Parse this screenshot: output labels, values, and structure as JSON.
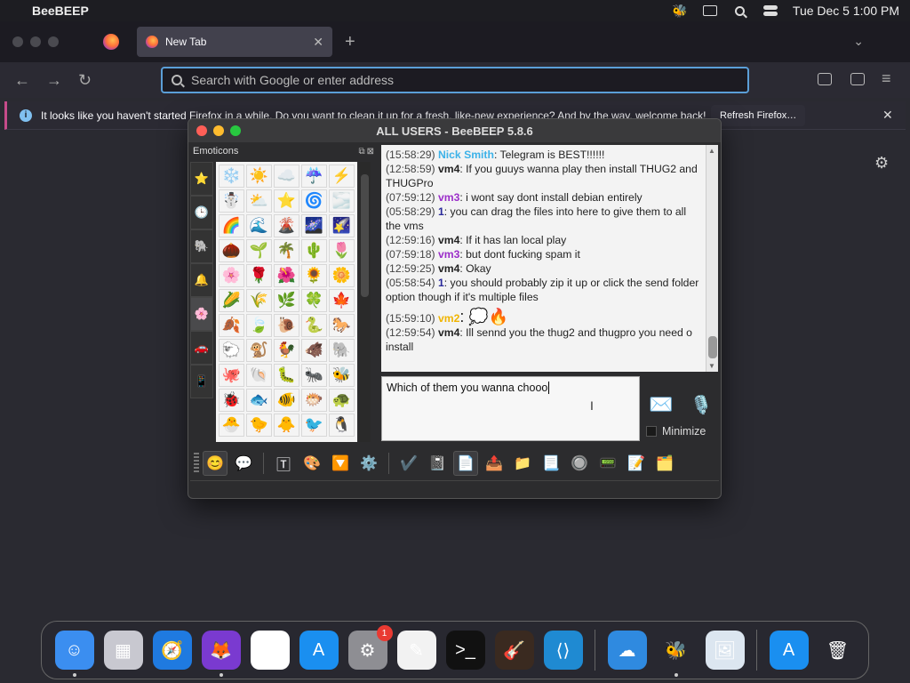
{
  "menubar": {
    "app_name": "BeeBEEP",
    "clock": "Tue Dec 5  1:00 PM"
  },
  "firefox": {
    "tab_title": "New Tab",
    "url_placeholder": "Search with Google or enter address",
    "notice_text": "It looks like you haven't started Firefox in a while. Do you want to clean it up for a fresh, like-new experience? And by the way, welcome back!",
    "refresh_label": "Refresh Firefox…"
  },
  "beebeep": {
    "title": "ALL USERS - BeeBEEP 5.8.6",
    "emoticons_label": "Emoticons",
    "emoticon_categories": [
      "⭐",
      "🕒",
      "🐘",
      "🔔",
      "🌸",
      "🚗",
      "📱"
    ],
    "emoticons": [
      "❄️",
      "☀️",
      "☁️",
      "☔",
      "⚡",
      "☃️",
      "⛅",
      "⭐",
      "🌀",
      "🌫️",
      "🌈",
      "🌊",
      "🌋",
      "🌌",
      "🌠",
      "🌰",
      "🌱",
      "🌴",
      "🌵",
      "🌷",
      "🌸",
      "🌹",
      "🌺",
      "🌻",
      "🌼",
      "🌽",
      "🌾",
      "🌿",
      "🍀",
      "🍁",
      "🍂",
      "🍃",
      "🐌",
      "🐍",
      "🐎",
      "🐑",
      "🐒",
      "🐓",
      "🐗",
      "🐘",
      "🐙",
      "🐚",
      "🐛",
      "🐜",
      "🐝",
      "🐞",
      "🐟",
      "🐠",
      "🐡",
      "🐢",
      "🐣",
      "🐤",
      "🐥",
      "🐦",
      "🐧"
    ],
    "messages": [
      {
        "time": "(15:58:29)",
        "sender": "Nick Smith",
        "color": "#3db2e8",
        "text": ": Telegram is BEST!!!!!!"
      },
      {
        "time": "(12:58:59)",
        "sender": "vm4",
        "color": "#222222",
        "text": ": If you guuys wanna play then install THUG2 and THUGPro"
      },
      {
        "time": "(07:59:12)",
        "sender": "vm3",
        "color": "#9b2ec9",
        "text": ": i wont say dont install debian entirely"
      },
      {
        "time": "(05:58:29)",
        "sender": "1",
        "color": "#2a2a9a",
        "text": ": you can drag the files into here to give them to all the vms"
      },
      {
        "time": "(12:59:16)",
        "sender": "vm4",
        "color": "#222222",
        "text": ": If it has lan local play"
      },
      {
        "time": "(07:59:18)",
        "sender": "vm3",
        "color": "#9b2ec9",
        "text": ": but dont fucking spam it"
      },
      {
        "time": "(12:59:25)",
        "sender": "vm4",
        "color": "#222222",
        "text": ": Okay"
      },
      {
        "time": "(05:58:54)",
        "sender": "1",
        "color": "#2a2a9a",
        "text": ": you should probably zip it up or click the send folder option though if it's multiple files"
      },
      {
        "time": "(15:59:10)",
        "sender": "vm2",
        "color": "#f0b400",
        "text": ": 💭🔥"
      },
      {
        "time": "(12:59:54)",
        "sender": "vm4",
        "color": "#222222",
        "text": ": Ill sennd you the thug2 and thugpro you need o install"
      }
    ],
    "input_value": "Which of them you wanna chooo",
    "minimize_label": "Minimize",
    "toolbar_icons": [
      "😊",
      "💬",
      "🅃",
      "🎨",
      "🔽",
      "⚙️",
      "✔️",
      "📓",
      "📄",
      "📤",
      "📁",
      "📃",
      "🔘",
      "📟",
      "📝",
      "🗂️"
    ]
  },
  "dock": [
    {
      "name": "finder",
      "glyph": "☺",
      "bg": "#3b8ef0",
      "running": true
    },
    {
      "name": "launchpad",
      "glyph": "▦",
      "bg": "#c8c8d0"
    },
    {
      "name": "safari",
      "glyph": "🧭",
      "bg": "#1f7ae0"
    },
    {
      "name": "firefox",
      "glyph": "🦊",
      "bg": "#7a3ad0",
      "running": true
    },
    {
      "name": "chrome",
      "glyph": "◉",
      "bg": "#ffffff"
    },
    {
      "name": "app-store",
      "glyph": "A",
      "bg": "#1a8ff0"
    },
    {
      "name": "system-settings",
      "glyph": "⚙",
      "bg": "#8e8e93",
      "badge": "1"
    },
    {
      "name": "textedit",
      "glyph": "✎",
      "bg": "#f2f2f2"
    },
    {
      "name": "terminal",
      "glyph": ">_",
      "bg": "#111111"
    },
    {
      "name": "garageband",
      "glyph": "🎸",
      "bg": "#3a2a20"
    },
    {
      "name": "vscode",
      "glyph": "⟨⟩",
      "bg": "#1f8ad2"
    },
    {
      "name": "weather",
      "glyph": "☁",
      "bg": "#2f8ae0"
    },
    {
      "name": "beebeep",
      "glyph": "🐝",
      "bg": "transparent",
      "running": true
    },
    {
      "name": "preview",
      "glyph": "🖼",
      "bg": "#dce6f0"
    },
    {
      "name": "app-store-downloads",
      "glyph": "A",
      "bg": "#1a8ff0"
    },
    {
      "name": "trash",
      "glyph": "🗑",
      "bg": "transparent"
    }
  ]
}
